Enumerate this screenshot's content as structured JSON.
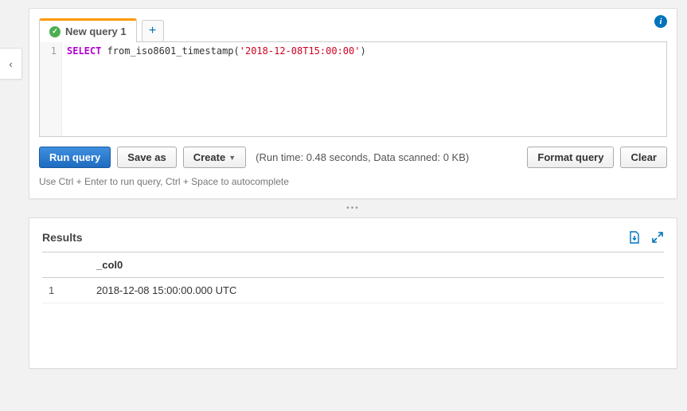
{
  "sidebar_collapse_glyph": "‹",
  "info_glyph": "i",
  "tabs": {
    "active": {
      "label": "New query 1",
      "status": "success"
    },
    "add_glyph": "+"
  },
  "editor": {
    "line_number": "1",
    "sql_keyword": "SELECT",
    "sql_func": " from_iso8601_timestamp(",
    "sql_string": "'2018-12-08T15:00:00'",
    "sql_end": ")"
  },
  "toolbar": {
    "run": "Run query",
    "save_as": "Save as",
    "create": "Create",
    "stats": "(Run time: 0.48 seconds, Data scanned: 0 KB)",
    "format": "Format query",
    "clear": "Clear"
  },
  "hint": "Use Ctrl + Enter to run query, Ctrl + Space to autocomplete",
  "grab_glyph": "•••",
  "results": {
    "title": "Results",
    "columns": {
      "idx": "",
      "col0": "_col0"
    },
    "rows": [
      {
        "idx": "1",
        "col0": "2018-12-08 15:00:00.000 UTC"
      }
    ]
  }
}
